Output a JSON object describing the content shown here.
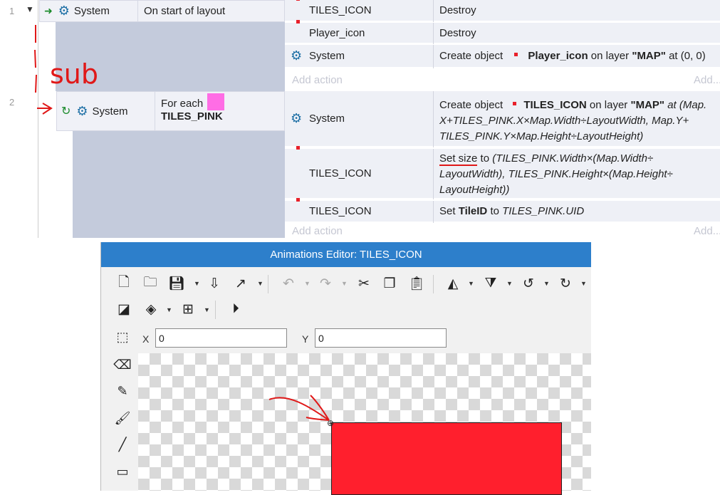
{
  "event_sheet": {
    "event1": {
      "number": "1",
      "condition_object": "System",
      "condition_text": "On start of layout",
      "actions": [
        {
          "object": "TILES_ICON",
          "text": "Destroy"
        },
        {
          "object": "Player_icon",
          "text": "Destroy"
        },
        {
          "object": "System",
          "text_pre": "Create object",
          "obj": "Player_icon",
          "mid": "on layer",
          "layer": "\"MAP\"",
          "tail": "at (0, 0)"
        }
      ],
      "add_action": "Add action",
      "add_more": "Add..."
    },
    "event2": {
      "number": "2",
      "condition_object": "System",
      "condition_text": "For each",
      "condition_target": "TILES_PINK",
      "actions": [
        {
          "object": "System",
          "pre": "Create object",
          "obj": "TILES_ICON",
          "mid": "on layer",
          "layer": "\"MAP\"",
          "at": "at (Map.",
          "line2": "X+TILES_PINK.X×Map.Width÷LayoutWidth, Map.Y+",
          "line3": "TILES_PINK.Y×Map.Height÷LayoutHeight)"
        },
        {
          "object": "TILES_ICON",
          "pre": "Set size",
          "to": "to",
          "line1": "(TILES_PINK.Width×(Map.Width÷",
          "line2": "LayoutWidth), TILES_PINK.Height×(Map.Height÷",
          "line3": "LayoutHeight))"
        },
        {
          "object": "TILES_ICON",
          "pre": "Set",
          "bold": "TileID",
          "to": "to",
          "expr": "TILES_PINK.UID"
        }
      ],
      "add_action": "Add action",
      "add_more": "Add..."
    },
    "annotation": "sub",
    "colors": {
      "pink": "#ff6de5",
      "accent_red": "#e01818",
      "tile_red": "#ff1f2d"
    }
  },
  "anim_editor": {
    "title": "Animations Editor: TILES_ICON",
    "x_label": "X",
    "x_value": "0",
    "y_label": "Y",
    "y_value": "0",
    "toolbar_icons": [
      "new-file-icon",
      "open-folder-icon",
      "save-icon",
      "export-icon",
      "external-icon",
      "undo-icon",
      "redo-icon",
      "cut-icon",
      "copy-icon",
      "paste-icon",
      "flip-horizontal-icon",
      "flip-vertical-icon",
      "rotate-ccw-icon",
      "rotate-cw-icon",
      "color-icon",
      "layers-icon",
      "grid-icon",
      "play-icon"
    ],
    "tools": [
      "rect-select-icon",
      "eraser-icon",
      "pencil-icon",
      "brush-icon",
      "line-icon",
      "rectangle-icon"
    ]
  }
}
